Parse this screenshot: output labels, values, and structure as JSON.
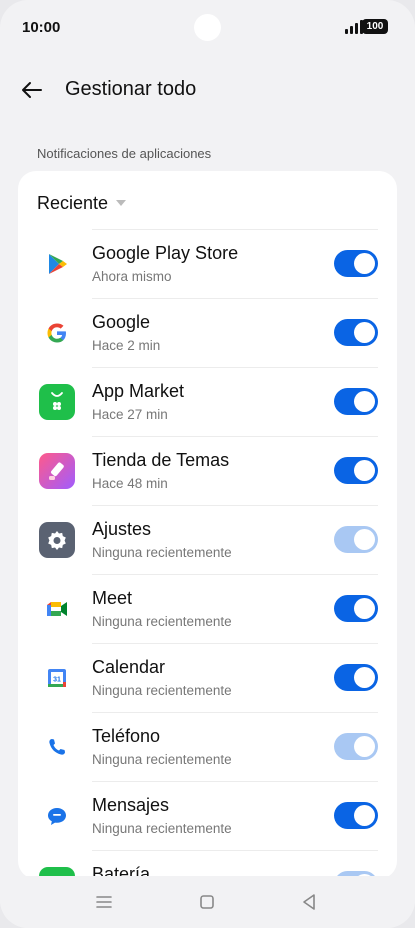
{
  "status_bar": {
    "time": "10:00",
    "battery": "100"
  },
  "header": {
    "title": "Gestionar todo"
  },
  "section_label": "Notificaciones de aplicaciones",
  "sort": {
    "label": "Reciente"
  },
  "apps": [
    {
      "name": "Google Play Store",
      "sub": "Ahora mismo",
      "icon": "google-play-icon",
      "enabled": true,
      "disabled": false
    },
    {
      "name": "Google",
      "sub": "Hace 2 min",
      "icon": "google-icon",
      "enabled": true,
      "disabled": false
    },
    {
      "name": "App Market",
      "sub": "Hace 27 min",
      "icon": "app-market-icon",
      "enabled": true,
      "disabled": false
    },
    {
      "name": "Tienda de Temas",
      "sub": "Hace 48 min",
      "icon": "theme-store-icon",
      "enabled": true,
      "disabled": false
    },
    {
      "name": "Ajustes",
      "sub": "Ninguna recientemente",
      "icon": "settings-gear-icon",
      "enabled": true,
      "disabled": true
    },
    {
      "name": "Meet",
      "sub": "Ninguna recientemente",
      "icon": "meet-icon",
      "enabled": true,
      "disabled": false
    },
    {
      "name": "Calendar",
      "sub": "Ninguna recientemente",
      "icon": "calendar-icon",
      "enabled": true,
      "disabled": false
    },
    {
      "name": "Teléfono",
      "sub": "Ninguna recientemente",
      "icon": "phone-icon",
      "enabled": true,
      "disabled": true
    },
    {
      "name": "Mensajes",
      "sub": "Ninguna recientemente",
      "icon": "messages-icon",
      "enabled": true,
      "disabled": false
    },
    {
      "name": "Batería",
      "sub": "",
      "icon": "battery-app-icon",
      "enabled": true,
      "disabled": true
    }
  ],
  "colors": {
    "accent": "#0a64e4",
    "accent_disabled": "#a9c8f3",
    "background": "#f2f2f4"
  }
}
